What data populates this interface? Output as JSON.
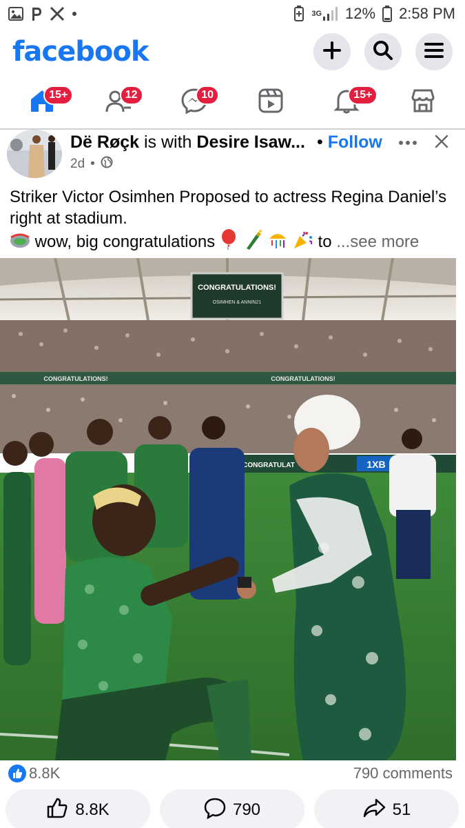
{
  "status_bar": {
    "left_icons": [
      "gallery-icon",
      "pinterest-icon",
      "x-icon",
      "dot-icon"
    ],
    "network": "3G",
    "battery": "12%",
    "time": "2:58 PM"
  },
  "header": {
    "logo": "facebook",
    "actions": [
      "plus-icon",
      "search-icon",
      "menu-icon"
    ]
  },
  "nav": {
    "tabs": [
      {
        "name": "home",
        "badge": "15+"
      },
      {
        "name": "friends",
        "badge": "12"
      },
      {
        "name": "messenger",
        "badge": "10"
      },
      {
        "name": "video",
        "badge": ""
      },
      {
        "name": "notifications",
        "badge": "15+"
      },
      {
        "name": "marketplace",
        "badge": ""
      }
    ]
  },
  "post": {
    "author": "Dë Røçk",
    "with_text": "is with",
    "tagged": "Desire Isaw...",
    "follow_dot": "•",
    "follow_label": "Follow",
    "time": "2d",
    "meta_sep": "•",
    "text_line1": "Striker Victor Osimhen Proposed to actress Regina Daniel’s right at stadium.",
    "text_line2_prefix": "wow, big congratulations",
    "text_line2_to": "to",
    "see_more": "...see more",
    "photo_board_title": "CONGRATULATIONS!",
    "photo_board_sub": "OSIMHEN & ANNIN21",
    "photo_ad_1": "CONGRATULATIONS!",
    "photo_ad_2": "CONGRATULATIONS!",
    "photo_ad_3": "CONGRATULAT",
    "photo_ad_4": "1XB"
  },
  "summary": {
    "likes": "8.8K",
    "comments": "790 comments"
  },
  "actions": {
    "like": "8.8K",
    "comment": "790",
    "share": "51"
  },
  "colors": {
    "brand": "#1877f2",
    "badge": "#e41e3f",
    "button_bg": "#e4e6eb",
    "pill_bg": "#f0f2f5",
    "muted": "#65676b"
  }
}
